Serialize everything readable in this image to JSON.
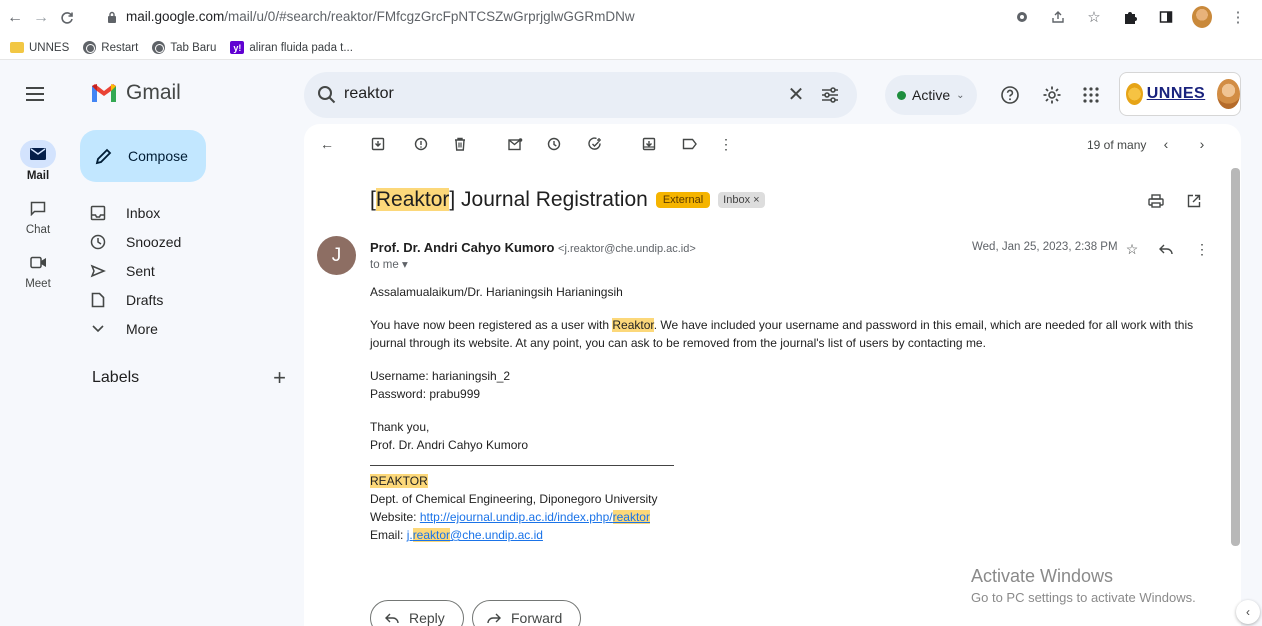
{
  "browser": {
    "url_host": "mail.google.com",
    "url_path": "/mail/u/0/#search/reaktor/FMfcgzGrcFpNTCSZwGrprjglwGGRmDNw",
    "bookmarks": [
      "UNNES",
      "Restart",
      "Tab Baru",
      "aliran fluida pada t..."
    ]
  },
  "gmail": {
    "app_name": "Gmail",
    "search_query": "reaktor",
    "status_label": "Active",
    "org_label": "UNNES"
  },
  "rail": {
    "mail": "Mail",
    "chat": "Chat",
    "meet": "Meet"
  },
  "nav": {
    "compose": "Compose",
    "items": [
      "Inbox",
      "Snoozed",
      "Sent",
      "Drafts",
      "More"
    ],
    "labels_title": "Labels"
  },
  "message": {
    "counter": "19 of many",
    "subject_highlight": "Reaktor",
    "subject_rest": "] Journal Registration",
    "subject_open": "[",
    "badge_external": "External",
    "badge_inbox": "Inbox ×",
    "sender_initial": "J",
    "sender_name": "Prof. Dr. Andri Cahyo Kumoro",
    "sender_email": "<j.reaktor@che.undip.ac.id>",
    "to_me": "to me ▾",
    "date": "Wed, Jan 25, 2023, 2:38 PM",
    "greeting": "Assalamualaikum/Dr. Harianingsih Harianingsih",
    "para1_pre": "You have now been registered as a user with ",
    "para1_hl": "Reaktor",
    "para1_post": ". We have included your username and password in this email, which are needed for all work with this journal through its website. At any point, you can ask to be removed from the journal's list of users by contacting me.",
    "username": "Username: harianingsih_2",
    "password": "Password: prabu999",
    "thanks": "Thank you,",
    "signature_name": "Prof. Dr. Andri Cahyo Kumoro",
    "rule": "________________________________________",
    "sig_org": "REAKTOR",
    "sig_dept": "Dept. of Chemical Engineering, Diponegoro University",
    "website_label": "Website: ",
    "website_pre": "http://ejournal.undip.ac.id/index.php/",
    "website_hl": "reaktor",
    "email_label": "Email: ",
    "email_pre": "j.",
    "email_hl": "reaktor",
    "email_post": "@che.undip.ac.id",
    "reply": "Reply",
    "forward": "Forward"
  },
  "watermark": {
    "line1": "Activate Windows",
    "line2": "Go to PC settings to activate Windows."
  },
  "colors": {
    "highlight": "#fcd87a",
    "compose_bg": "#c2e7ff",
    "external_badge": "#f5b400",
    "link": "#1a73e8"
  }
}
